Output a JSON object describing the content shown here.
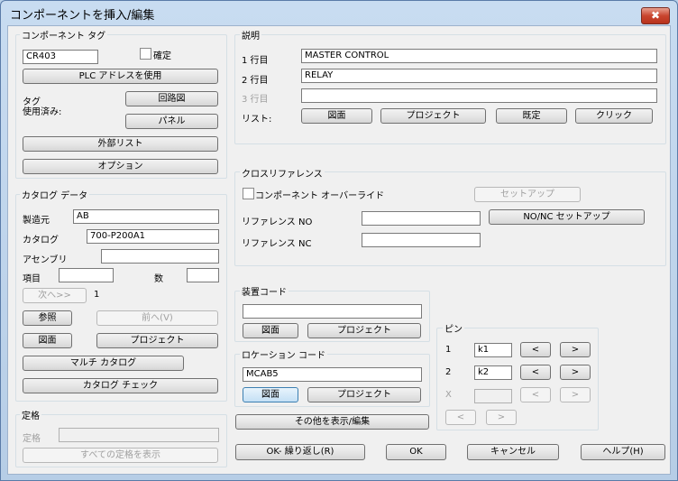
{
  "window": {
    "title": "コンポーネントを挿入/編集",
    "close_glyph": "✖"
  },
  "component_tag": {
    "group_label": "コンポーネント タグ",
    "tag_value": "CR403",
    "fixed_label": "確定",
    "plc_button": "PLC アドレスを使用",
    "tag_used_label": "タグ\n使用済み:",
    "schematic_button": "回路図",
    "panel_button": "パネル",
    "external_list_button": "外部リスト",
    "options_button": "オプション"
  },
  "catalog_data": {
    "group_label": "カタログ データ",
    "manufacturer_label": "製造元",
    "manufacturer_value": "AB",
    "catalog_label": "カタログ",
    "catalog_value": "700-P200A1",
    "assembly_label": "アセンブリ",
    "assembly_value": "",
    "item_label": "項目",
    "item_value": "",
    "qty_label": "数",
    "qty_value": "",
    "next_button": "次へ>>",
    "count_value": "1",
    "lookup_button": "参照",
    "previous_button": "前へ(V)",
    "drawing_button": "図面",
    "project_button": "プロジェクト",
    "multi_catalog_button": "マルチ カタログ",
    "catalog_check_button": "カタログ チェック"
  },
  "rating": {
    "group_label": "定格",
    "rating_label": "定格",
    "rating_value": "",
    "show_all_button": "すべての定格を表示"
  },
  "description": {
    "group_label": "説明",
    "line1_label": "1 行目",
    "line1_value": "MASTER CONTROL",
    "line2_label": "2 行目",
    "line2_value": "RELAY",
    "line3_label": "3 行目",
    "line3_value": "",
    "list_label": "リスト:",
    "list_buttons": [
      "図面",
      "プロジェクト",
      "既定",
      "クリック"
    ]
  },
  "cross_reference": {
    "group_label": "クロスリファレンス",
    "override_label": "コンポーネント オーバーライド",
    "setup_button": "セットアップ",
    "ref_no_label": "リファレンス NO",
    "ref_no_value": "",
    "nonc_setup_button": "NO/NC セットアップ",
    "ref_nc_label": "リファレンス NC",
    "ref_nc_value": ""
  },
  "installation_code": {
    "group_label": "装置コード",
    "value": "",
    "drawing_button": "図面",
    "project_button": "プロジェクト"
  },
  "location_code": {
    "group_label": "ロケーション コード",
    "value": "MCAB5",
    "drawing_button": "図面",
    "project_button": "プロジェクト"
  },
  "pins": {
    "group_label": "ピン",
    "rows": [
      {
        "label": "1",
        "value": "k1",
        "prev": "<",
        "next": ">"
      },
      {
        "label": "2",
        "value": "k2",
        "prev": "<",
        "next": ">"
      },
      {
        "label": "X",
        "value": "",
        "prev": "<",
        "next": ">"
      }
    ],
    "nav_prev": "<",
    "nav_next": ">"
  },
  "show_edit_others_button": "その他を表示/編集",
  "footer": {
    "ok_repeat_button": "OK- 繰り返し(R)",
    "ok_button": "OK",
    "cancel_button": "キャンセル",
    "help_button": "ヘルプ(H)"
  }
}
